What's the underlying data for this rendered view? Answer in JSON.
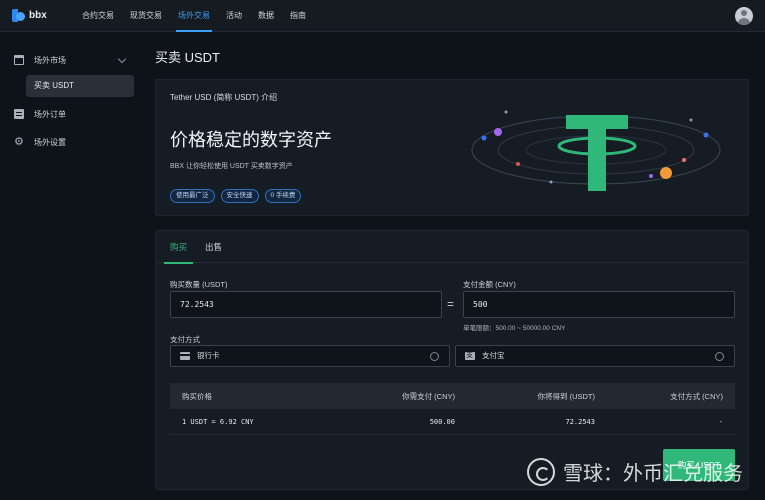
{
  "header": {
    "logo_text": "bbx",
    "nav": [
      {
        "label": "合约交易",
        "active": false
      },
      {
        "label": "现货交易",
        "active": false
      },
      {
        "label": "场外交易",
        "active": true
      },
      {
        "label": "活动",
        "active": false
      },
      {
        "label": "数据",
        "active": false
      },
      {
        "label": "指南",
        "active": false
      }
    ],
    "avatar_icon": "user-avatar-icon"
  },
  "sidebar": {
    "market": {
      "label": "场外市场",
      "icon": "store-icon",
      "expanded": true
    },
    "market_sub": {
      "label": "买卖 USDT",
      "selected": true
    },
    "orders": {
      "label": "场外订单",
      "icon": "document-icon"
    },
    "settings": {
      "label": "场外设置",
      "icon": "gear-icon"
    }
  },
  "page": {
    "title": "买卖 USDT"
  },
  "hero": {
    "subtitle": "Tether USD (简称 USDT) 介绍",
    "headline": "价格稳定的数字资产",
    "description": "BBX 让你轻松使用 USDT 买卖数字资产",
    "badges": [
      "使用最广泛",
      "安全快速",
      "0 手续费"
    ],
    "art_icon": "tether-logo-icon",
    "colors": {
      "tether_green": "#2fb87a",
      "accent_blue": "#3a6ff0",
      "accent_orange": "#f59a3a",
      "accent_purple": "#a266f0"
    }
  },
  "trade": {
    "tabs": [
      {
        "label": "购买",
        "active": true
      },
      {
        "label": "出售",
        "active": false
      }
    ],
    "quantity": {
      "label": "购买数量 (USDT)",
      "value": "72.2543"
    },
    "equals": "=",
    "amount": {
      "label": "支付金额 (CNY)",
      "value": "500"
    },
    "limit_text": "单笔限额：500.00 ~ 50000.00 CNY",
    "payment": {
      "label": "支付方式",
      "options": [
        {
          "label": "银行卡",
          "icon": "bank-card-icon",
          "selected": false
        },
        {
          "label": "支付宝",
          "icon": "alipay-icon",
          "selected": false
        }
      ]
    },
    "table": {
      "headers": [
        "购买价格",
        "你需支付 (CNY)",
        "你将得到 (USDT)",
        "支付方式 (CNY)"
      ],
      "row": [
        "1 USDT = 6.92 CNY",
        "500.00",
        "72.2543",
        "-"
      ]
    },
    "buy_button": "购买 USDT",
    "accent": "#2fb87a"
  },
  "watermark": {
    "text": "雪球：外币汇兑服务",
    "icon": "snowball-logo-icon"
  }
}
